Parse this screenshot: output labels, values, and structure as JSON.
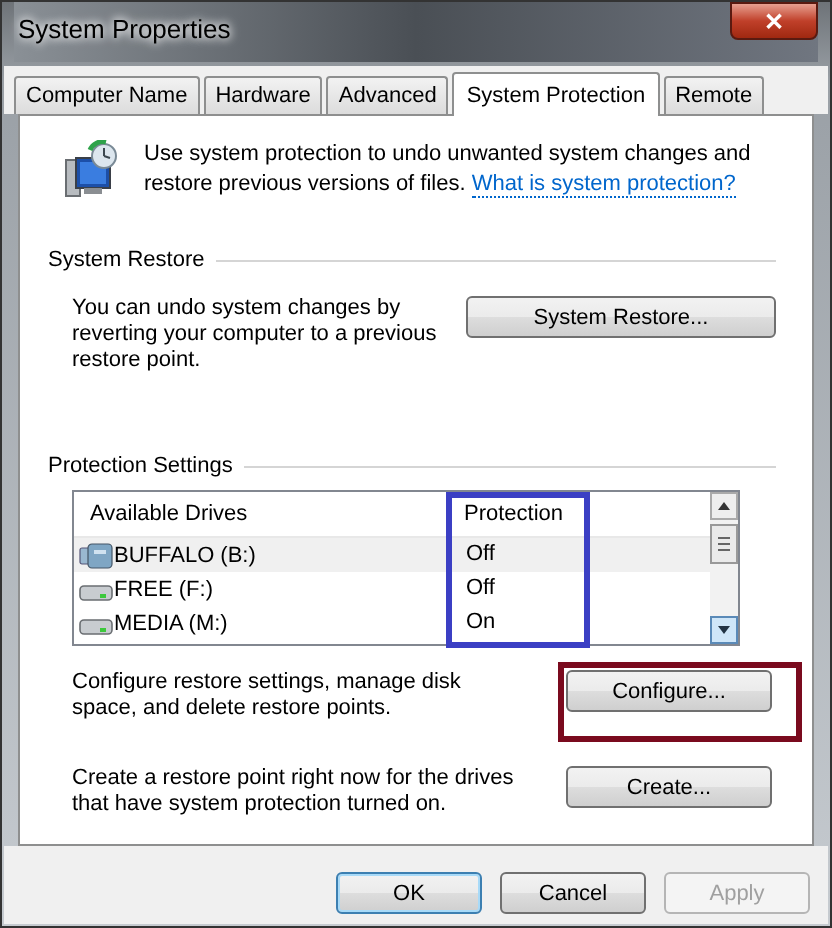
{
  "window": {
    "title": "System Properties",
    "close": "✕"
  },
  "tabs": [
    {
      "label": "Computer Name",
      "selected": false
    },
    {
      "label": "Hardware",
      "selected": false
    },
    {
      "label": "Advanced",
      "selected": false
    },
    {
      "label": "System Protection",
      "selected": true
    },
    {
      "label": "Remote",
      "selected": false
    }
  ],
  "intro": {
    "text": "Use system protection to undo unwanted system changes and restore previous versions of files.",
    "link": "What is system protection?"
  },
  "system_restore": {
    "heading": "System Restore",
    "text": "You can undo system changes by reverting your computer to a previous restore point.",
    "button": "System Restore..."
  },
  "protection_settings": {
    "heading": "Protection Settings",
    "columns": [
      "Available Drives",
      "Protection"
    ],
    "rows": [
      {
        "kind": "usb",
        "drive": "BUFFALO (B:)",
        "protection": "Off",
        "selected": true
      },
      {
        "kind": "disk",
        "drive": "FREE (F:)",
        "protection": "Off",
        "selected": false
      },
      {
        "kind": "disk",
        "drive": "MEDIA (M:)",
        "protection": "On",
        "selected": false
      }
    ],
    "configure_text": "Configure restore settings, manage disk space, and delete restore points.",
    "configure_button": "Configure...",
    "create_text": "Create a restore point right now for the drives that have system protection turned on.",
    "create_button": "Create..."
  },
  "buttons": [
    {
      "label": "OK",
      "kind": "default",
      "disabled": false
    },
    {
      "label": "Cancel",
      "kind": "normal",
      "disabled": false
    },
    {
      "label": "Apply",
      "kind": "normal",
      "disabled": true
    }
  ]
}
